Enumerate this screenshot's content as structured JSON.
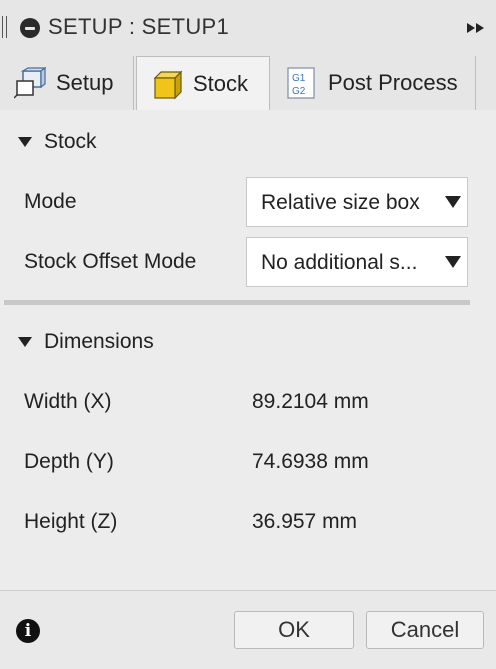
{
  "titlebar": {
    "title": "SETUP : SETUP1"
  },
  "tabs": [
    {
      "label": "Setup",
      "icon": "setup-icon"
    },
    {
      "label": "Stock",
      "icon": "stock-cube-icon"
    },
    {
      "label": "Post Process",
      "icon": "gcode-g1-g2-icon"
    }
  ],
  "stock": {
    "heading": "Stock",
    "mode_label": "Mode",
    "mode_value": "Relative size box",
    "offset_label": "Stock Offset Mode",
    "offset_value": "No additional s..."
  },
  "dimensions": {
    "heading": "Dimensions",
    "rows": [
      {
        "label": "Width (X)",
        "value": "89.2104 mm"
      },
      {
        "label": "Depth (Y)",
        "value": "74.6938 mm"
      },
      {
        "label": "Height (Z)",
        "value": "36.957 mm"
      }
    ]
  },
  "footer": {
    "ok_label": "OK",
    "cancel_label": "Cancel"
  },
  "colors": {
    "stock_icon": "#f0c419",
    "setup_icon": "#4a90d9",
    "panel_bg": "#ececec"
  }
}
